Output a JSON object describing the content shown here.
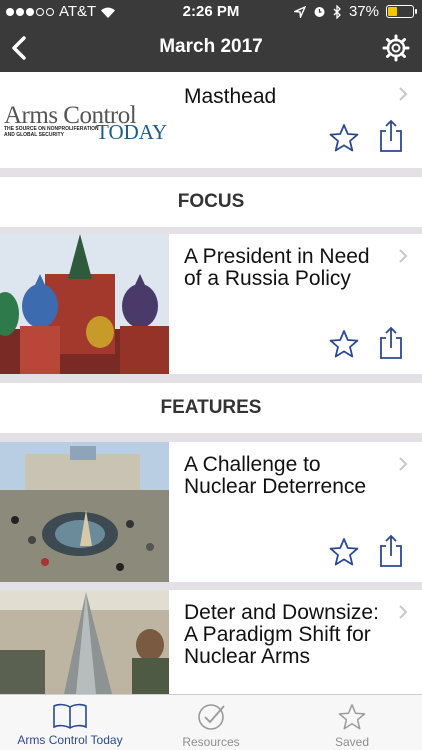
{
  "status": {
    "carrier": "AT&T",
    "time": "2:26 PM",
    "battery": "37%",
    "battery_level": 0.37
  },
  "nav": {
    "title": "March 2017"
  },
  "masthead": {
    "title": "Masthead",
    "logo_line1": "Arms Control",
    "logo_line2": "TODAY",
    "logo_tagline": "THE SOURCE ON NONPROLIFERATION AND GLOBAL SECURITY"
  },
  "sections": {
    "focus": "FOCUS",
    "features": "FEATURES"
  },
  "articles": [
    {
      "title": "A President in Need of a Russia Policy"
    },
    {
      "title": "A Challenge to Nuclear Deterrence"
    },
    {
      "title": "Deter and Downsize: A Paradigm Shift for Nuclear Arms"
    }
  ],
  "tabs": [
    {
      "label": "Arms Control Today"
    },
    {
      "label": "Resources"
    },
    {
      "label": "Saved"
    }
  ],
  "colors": {
    "accent": "#2c4a8d",
    "nav_bg": "#3a3a3a",
    "battery": "#f7c600",
    "separator": "#e3e1e6"
  },
  "icons": [
    "back-icon",
    "gear-icon",
    "chevron-right-icon",
    "star-icon",
    "share-icon",
    "book-icon",
    "check-circle-icon"
  ]
}
